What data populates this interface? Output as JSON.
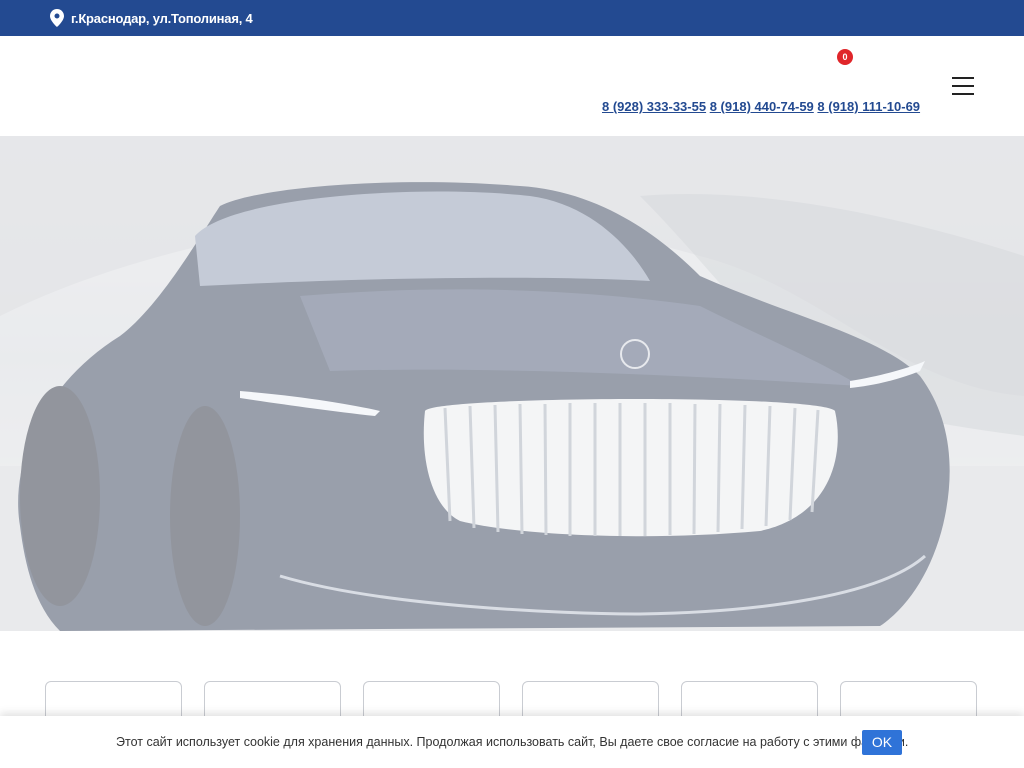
{
  "topbar": {
    "address": "г.Краснодар, ул.Тополиная, 4",
    "bg_color": "#234a91",
    "icon": "map-pin-icon"
  },
  "header": {
    "cart_count": "0",
    "phones": [
      "8 (928) 333-33-55",
      "8 (918) 440-74-59",
      "8 (918) 111-10-69"
    ],
    "menu_icon": "hamburger-icon",
    "link_color": "#234a91"
  },
  "hero": {
    "image": "car-photo"
  },
  "cards": {
    "count": 6
  },
  "cookie": {
    "text": "Этот сайт использует cookie для хранения данных. Продолжая использовать сайт, Вы даете свое согласие на работу с этими файлами.",
    "ok_label": "OK",
    "button_color": "#2f73d8"
  }
}
